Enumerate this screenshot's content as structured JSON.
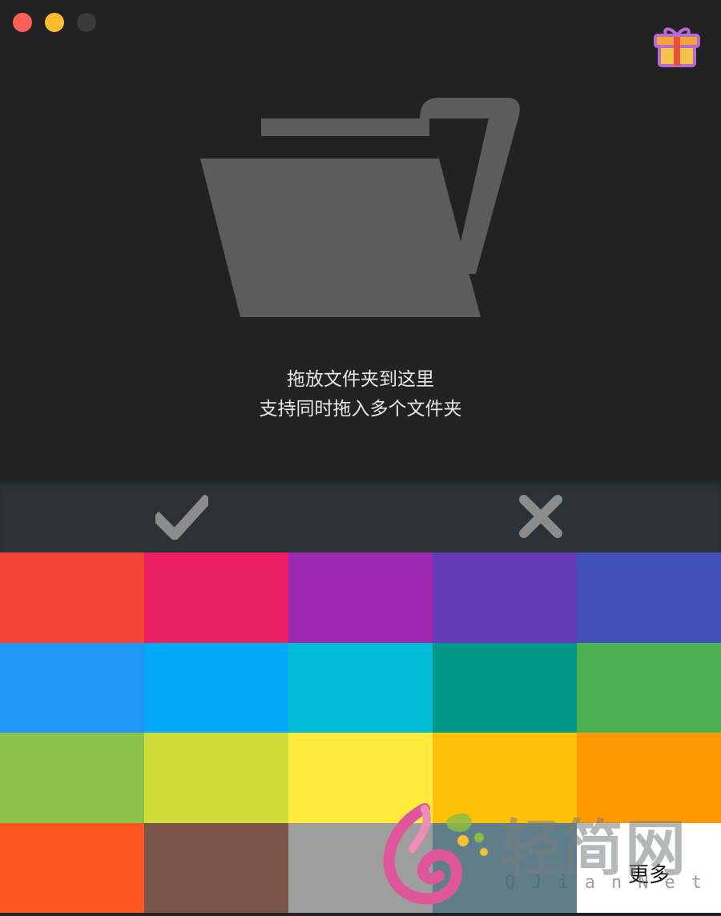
{
  "window": {
    "traffic_lights": {
      "close": "#fe5f57",
      "minimize": "#febc2e",
      "maximize": "#3a3a3c"
    },
    "gift_icon": "gift-icon"
  },
  "drop_zone": {
    "icon": "folder-open-icon",
    "line1": "拖放文件夹到这里",
    "line2": "支持同时拖入多个文件夹"
  },
  "actions": {
    "confirm_icon": "checkmark-icon",
    "cancel_icon": "close-icon"
  },
  "palette": {
    "colors": [
      "#f44336",
      "#e91e63",
      "#9c27b0",
      "#673ab7",
      "#3f51b5",
      "#2196f3",
      "#03a9f4",
      "#00bcd4",
      "#009688",
      "#4caf50",
      "#8bc34a",
      "#cddc39",
      "#ffeb3b",
      "#ffc107",
      "#ff9800",
      "#ff5722",
      "#795548",
      "#9e9e9e",
      "#607d8b"
    ],
    "more_label": "更多"
  },
  "watermark": {
    "cn": "轻简网",
    "en": "QJianNet"
  }
}
